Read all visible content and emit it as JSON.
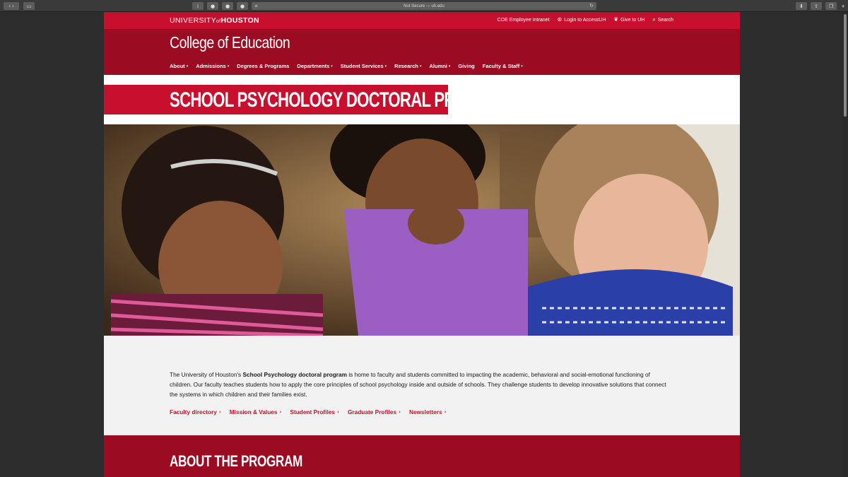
{
  "browser": {
    "address": "Not Secure — uh.edu"
  },
  "utility": {
    "logo_university": "UNIVERSITY",
    "logo_of": "of",
    "logo_houston": "HOUSTON",
    "links": [
      "COE Employee Intranet",
      "Login to AccessUH",
      "Give to UH",
      "Search"
    ]
  },
  "header": {
    "college": "College of Education",
    "nav": [
      {
        "label": "About",
        "dropdown": true
      },
      {
        "label": "Admissions",
        "dropdown": true
      },
      {
        "label": "Degrees & Programs",
        "dropdown": false
      },
      {
        "label": "Departments",
        "dropdown": true
      },
      {
        "label": "Student Services",
        "dropdown": true
      },
      {
        "label": "Research",
        "dropdown": true
      },
      {
        "label": "Alumni",
        "dropdown": true
      },
      {
        "label": "Giving",
        "dropdown": false
      },
      {
        "label": "Faculty & Staff",
        "dropdown": true
      }
    ]
  },
  "page_title": "SCHOOL PSYCHOLOGY DOCTORAL PROGRAM",
  "intro": {
    "before": "The University of Houston's ",
    "bold": "School Psychology doctoral program",
    "after": " is home to faculty and students committed to impacting the academic, behavioral and social-emotional functioning of children. Our faculty teaches students how to apply the core principles of school psychology inside and outside of schools. They challenge students to develop innovative solutions that connect the systems in which children and their families exist."
  },
  "quick_links": [
    "Faculty directory",
    "Mission & Values",
    "Student Profiles",
    "Graduate Profiles",
    "Newsletters"
  ],
  "about_heading": "ABOUT THE PROGRAM",
  "colors": {
    "red": "#c8102e",
    "dark_red": "#9b0b22",
    "light_gray": "#f2f2f2"
  }
}
